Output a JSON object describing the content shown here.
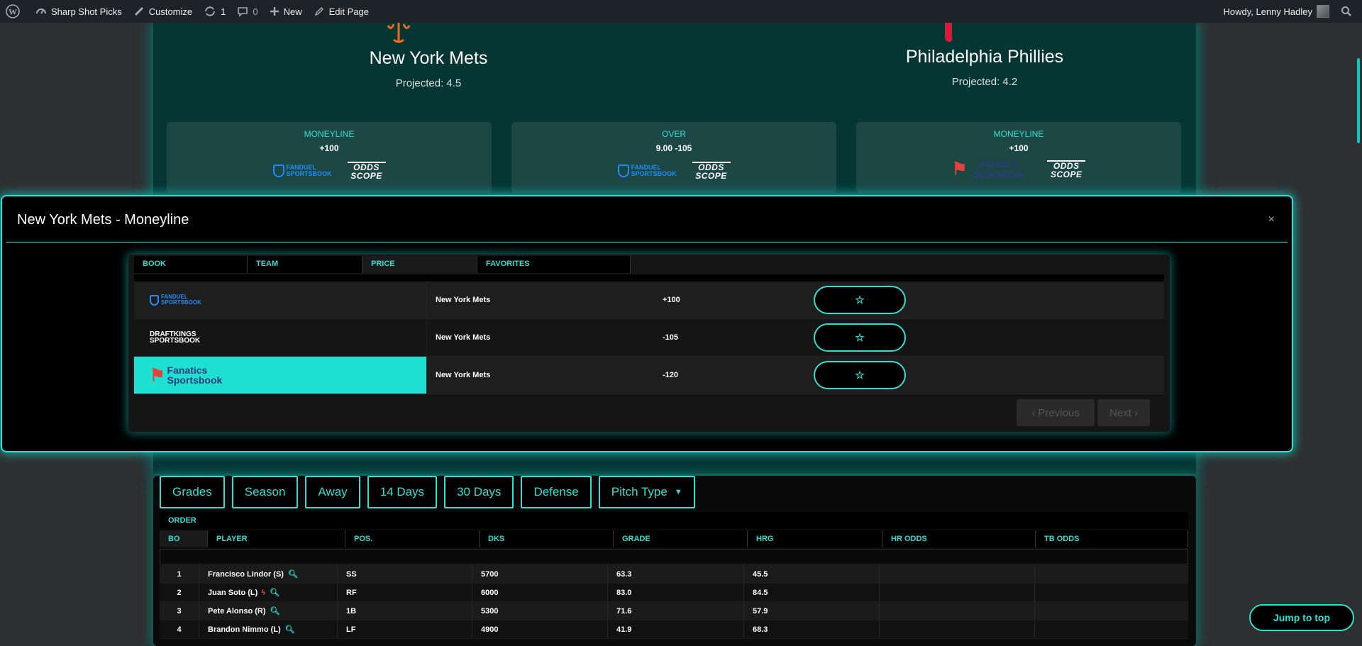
{
  "adminbar": {
    "site_name": "Sharp Shot Picks",
    "customize": "Customize",
    "updates": "1",
    "comments": "0",
    "new": "New",
    "edit_page": "Edit Page",
    "howdy": "Howdy, Lenny Hadley"
  },
  "matchup": {
    "away": {
      "name": "New York Mets",
      "projected": "Projected: 4.5"
    },
    "home": {
      "name": "Philadelphia Phillies",
      "projected": "Projected: 4.2"
    }
  },
  "bet_cards": [
    {
      "type": "MONEYLINE",
      "value": "+100",
      "book": "FANDUEL SPORTSBOOK",
      "partner": "ODDS SCOPE"
    },
    {
      "type": "OVER",
      "value": "9.00 -105",
      "book": "FANDUEL SPORTSBOOK",
      "partner": "ODDS SCOPE"
    },
    {
      "type": "MONEYLINE",
      "value": "+100",
      "book": "Fanatics Sportsbook",
      "partner": "ODDS SCOPE"
    }
  ],
  "modal": {
    "title": "New York Mets - Moneyline",
    "close": "×",
    "headers": [
      "BOOK",
      "TEAM",
      "PRICE",
      "FAVORITES"
    ],
    "rows": [
      {
        "book": "FANDUEL SPORTSBOOK",
        "team": "New York Mets",
        "price": "+100"
      },
      {
        "book": "DRAFTKINGS SPORTSBOOK",
        "team": "New York Mets",
        "price": "-105"
      },
      {
        "book": "Fanatics Sportsbook",
        "team": "New York Mets",
        "price": "-120"
      }
    ],
    "previous": "‹ Previous",
    "next": "Next ›"
  },
  "filters": [
    "Grades",
    "Season",
    "Away",
    "14 Days",
    "30 Days",
    "Defense",
    "Pitch Type"
  ],
  "lineup": {
    "order_label": "ORDER",
    "headers": [
      "BO",
      "PLAYER",
      "POS.",
      "DKS",
      "GRADE",
      "HRG",
      "HR ODDS",
      "TB ODDS"
    ],
    "rows": [
      {
        "bo": "1",
        "player": "Francisco Lindor (S)",
        "pos": "SS",
        "dks": "5700",
        "grade": "63.3",
        "hrg": "45.5"
      },
      {
        "bo": "2",
        "player": "Juan Soto (L)",
        "pos": "RF",
        "dks": "6000",
        "grade": "83.0",
        "hrg": "84.5"
      },
      {
        "bo": "3",
        "player": "Pete Alonso (R)",
        "pos": "1B",
        "dks": "5300",
        "grade": "71.6",
        "hrg": "57.9"
      },
      {
        "bo": "4",
        "player": "Brandon Nimmo (L)",
        "pos": "LF",
        "dks": "4900",
        "grade": "41.9",
        "hrg": "68.3"
      }
    ]
  },
  "jump_to_top": "Jump to top"
}
